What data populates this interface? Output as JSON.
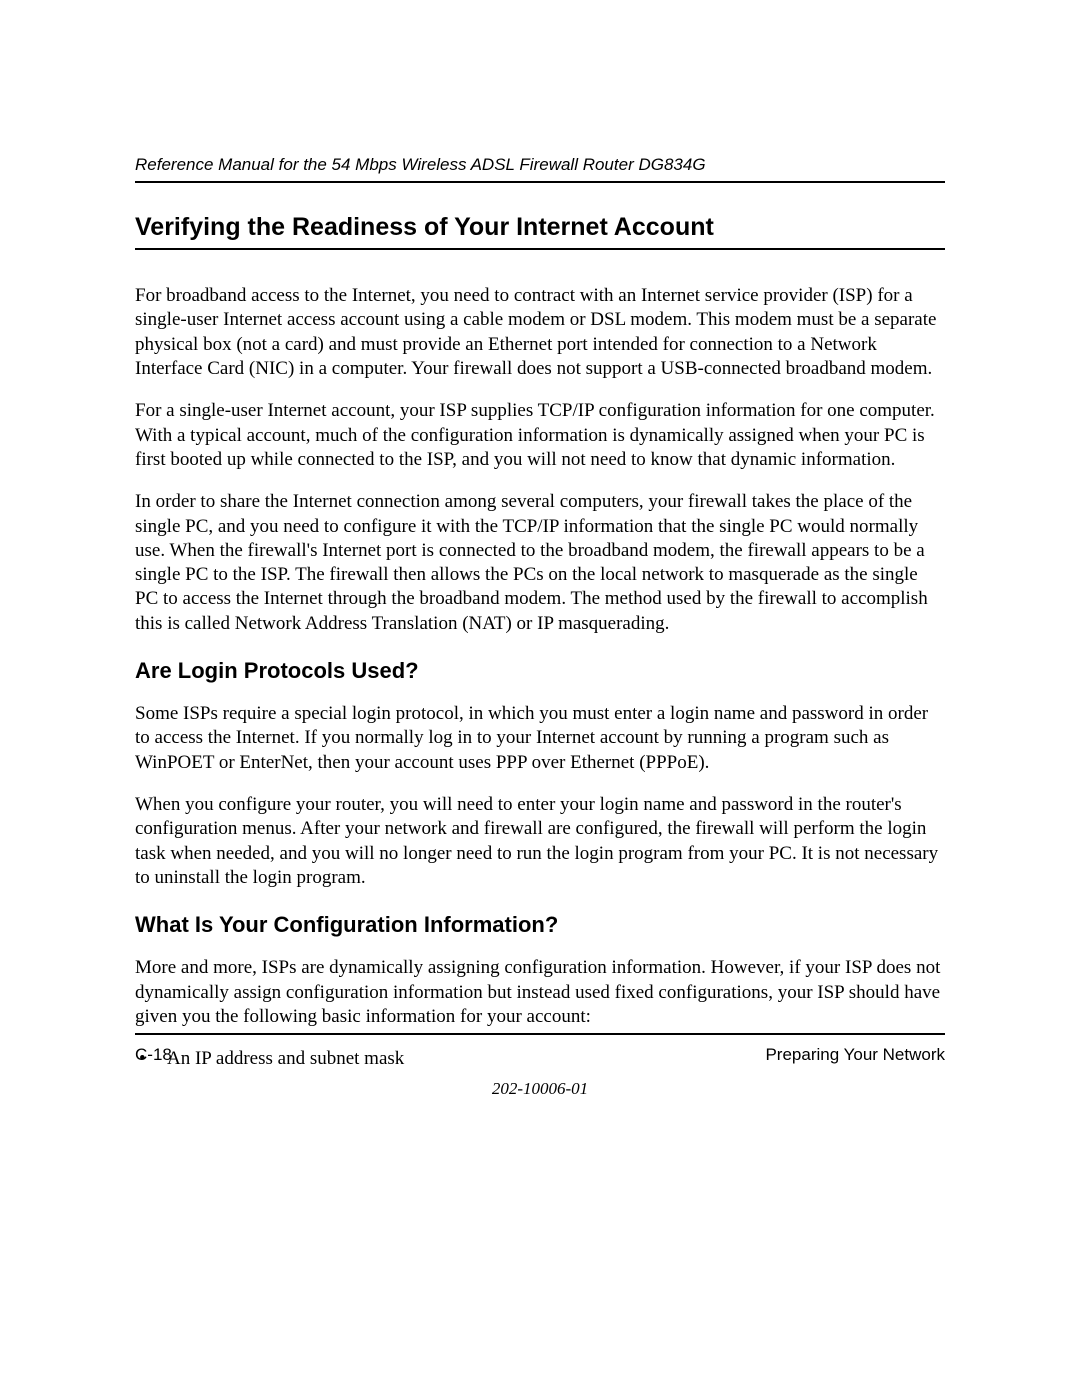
{
  "header": {
    "running_title": "Reference Manual for the 54 Mbps Wireless ADSL Firewall Router DG834G"
  },
  "section": {
    "title": "Verifying the Readiness of Your Internet Account",
    "paragraphs": [
      "For broadband access to the Internet, you need to contract with an Internet service provider (ISP) for a single-user Internet access account using a cable modem or DSL modem. This modem must be a separate physical box (not a card) and must provide an Ethernet port intended for connection to a Network Interface Card (NIC) in a computer. Your firewall does not support a USB-connected broadband modem.",
      "For a single-user Internet account, your ISP supplies TCP/IP configuration information for one computer. With a typical account, much of the configuration information is dynamically assigned when your PC is first booted up while connected to the ISP, and you will not need to know that dynamic information.",
      "In order to share the Internet connection among several computers, your firewall takes the place of the single PC, and you need to configure it with the TCP/IP information that the single PC would normally use. When the firewall's Internet port is connected to the broadband modem, the firewall appears to be a single PC to the ISP. The firewall then allows the PCs on the local network to masquerade as the single PC to access the Internet through the broadband modem. The method used by the firewall to accomplish this is called Network Address Translation (NAT) or IP masquerading."
    ]
  },
  "subsection1": {
    "title": "Are Login Protocols Used?",
    "paragraphs": [
      "Some ISPs require a special login protocol, in which you must enter a login name and password in order to access the Internet. If you normally log in to your Internet account by running a program such as WinPOET or EnterNet, then your account uses PPP over Ethernet (PPPoE).",
      "When you configure your router, you will need to enter your login name and password in the router's configuration menus. After your network and firewall are configured, the firewall will perform the login task when needed, and you will no longer need to run the login program from your PC. It is not necessary to uninstall the login program."
    ]
  },
  "subsection2": {
    "title": "What Is Your Configuration Information?",
    "paragraphs": [
      "More and more, ISPs are dynamically assigning configuration information. However, if your ISP does not dynamically assign configuration information but instead used fixed configurations, your ISP should have given you the following basic information for your account:"
    ],
    "bullets": [
      "An IP address and subnet mask"
    ]
  },
  "footer": {
    "page_number": "C-18",
    "section_name": "Preparing Your Network",
    "doc_number": "202-10006-01"
  }
}
